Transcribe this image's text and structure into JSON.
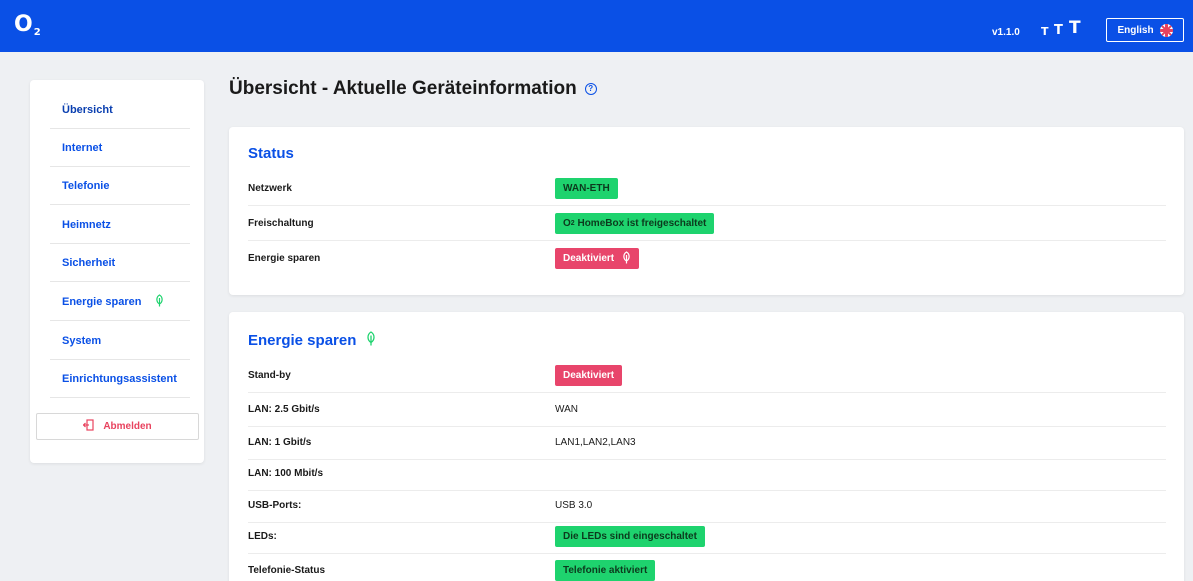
{
  "header": {
    "logo": "O",
    "logo_sub": "2",
    "version": "v1.1.0",
    "text_sizes": [
      "T",
      "T",
      "T"
    ],
    "language_button": "English",
    "language_flag_icon": "uk-flag-icon",
    "colors": {
      "brand": "#0a50e6"
    }
  },
  "sidebar": {
    "items": [
      {
        "label": "Übersicht"
      },
      {
        "label": "Internet"
      },
      {
        "label": "Telefonie"
      },
      {
        "label": "Heimnetz"
      },
      {
        "label": "Sicherheit"
      },
      {
        "label": "Energie sparen",
        "icon": "leaf-icon"
      },
      {
        "label": "System"
      },
      {
        "label": "Einrichtungsassistent"
      }
    ],
    "logout_label": "Abmelden",
    "logout_icon": "logout-icon"
  },
  "main": {
    "title": "Übersicht - Aktuelle Geräteinformation",
    "status_card": {
      "title": "Status",
      "rows": [
        {
          "label": "Netzwerk",
          "value": "WAN-ETH",
          "style": "green"
        },
        {
          "label": "Freischaltung",
          "value_prefix": "O",
          "value_sub": "2",
          "value": " HomeBox ist freigeschaltet",
          "style": "green"
        },
        {
          "label": "Energie sparen",
          "value": "Deaktiviert",
          "style": "red",
          "icon": "leaf-icon"
        }
      ]
    },
    "energy_card": {
      "title": "Energie sparen",
      "title_icon": "leaf-icon",
      "rows": [
        {
          "label": "Stand-by",
          "value": "Deaktiviert",
          "style": "red"
        },
        {
          "label": "LAN: 2.5 Gbit/s",
          "value": "WAN"
        },
        {
          "label": "LAN: 1 Gbit/s",
          "value": "LAN1,LAN2,LAN3"
        },
        {
          "label": "LAN: 100 Mbit/s",
          "value": ""
        },
        {
          "label": "USB-Ports:",
          "value": "USB 3.0"
        },
        {
          "label": "LEDs:",
          "value": "Die LEDs sind eingeschaltet",
          "style": "green"
        },
        {
          "label": "Telefonie-Status",
          "value": "Telefonie aktiviert",
          "style": "green"
        }
      ]
    }
  }
}
